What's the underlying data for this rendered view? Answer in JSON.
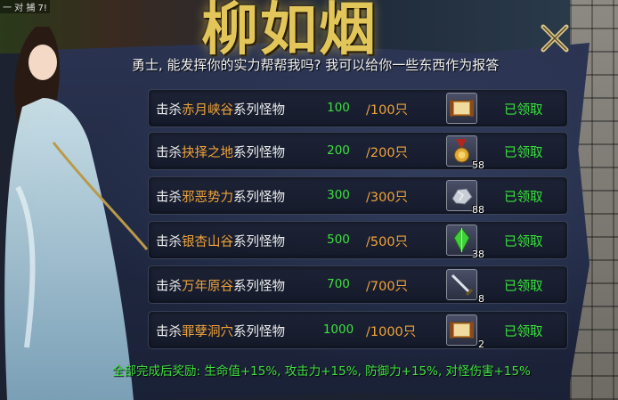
{
  "header": {
    "title": "柳如烟",
    "corner_text": "一 对 捕 7!"
  },
  "dialog": {
    "subtitle": "勇士, 能发挥你的实力帮帮我吗? 我可以给你一些东西作为报答",
    "close_icon": "close-x-icon"
  },
  "tasks": [
    {
      "prefix": "击杀",
      "zone": "赤月峡谷",
      "suffix": "系列怪物",
      "current": "100",
      "total": "/100只",
      "reward_icon": "scroll-book-icon",
      "reward_qty": "",
      "status": "已领取"
    },
    {
      "prefix": "击杀",
      "zone": "抉择之地",
      "suffix": "系列怪物",
      "current": "200",
      "total": "/200只",
      "reward_icon": "medal-icon",
      "reward_qty": "58",
      "status": "已领取"
    },
    {
      "prefix": "击杀",
      "zone": "邪恶势力",
      "suffix": "系列怪物",
      "current": "300",
      "total": "/300只",
      "reward_icon": "silver-ore-icon",
      "reward_qty": "88",
      "status": "已领取"
    },
    {
      "prefix": "击杀",
      "zone": "银杏山谷",
      "suffix": "系列怪物",
      "current": "500",
      "total": "/500只",
      "reward_icon": "green-crystal-icon",
      "reward_qty": "38",
      "status": "已领取"
    },
    {
      "prefix": "击杀",
      "zone": "万年原谷",
      "suffix": "系列怪物",
      "current": "700",
      "total": "/700只",
      "reward_icon": "sword-icon",
      "reward_qty": "8",
      "status": "已领取"
    },
    {
      "prefix": "击杀",
      "zone": "罪孽洞穴",
      "suffix": "系列怪物",
      "current": "1000",
      "total": "/1000只",
      "reward_icon": "scroll-book-icon",
      "reward_qty": "2",
      "status": "已领取"
    }
  ],
  "footer": {
    "bonus": "全部完成后奖励: 生命值+15%, 攻击力+15%, 防御力+15%, 对怪伤害+15%"
  },
  "colors": {
    "zone": "#f0a33a",
    "progress": "#3fe03f",
    "status": "#38e23a",
    "title_gold": "#e3c65a"
  }
}
